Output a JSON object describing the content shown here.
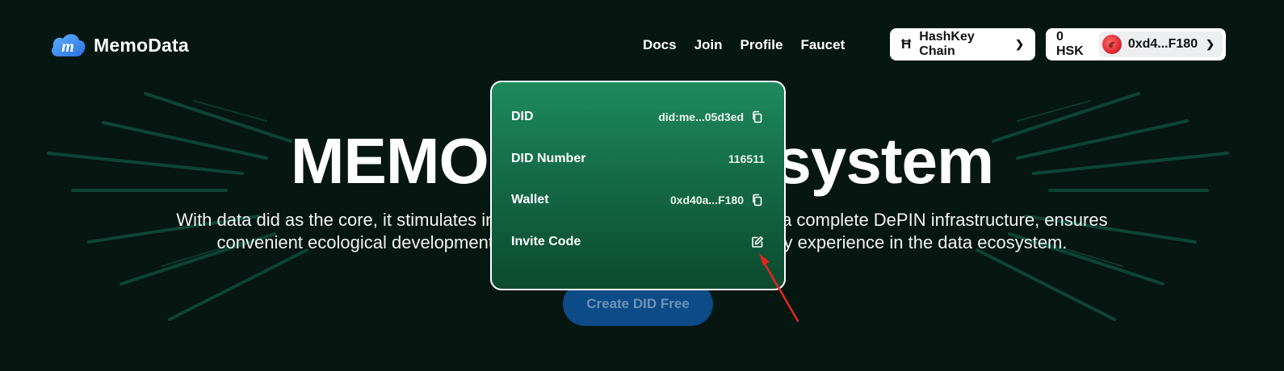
{
  "brand": {
    "name": "MemoData"
  },
  "nav": {
    "items": [
      "Docs",
      "Join",
      "Profile",
      "Faucet"
    ]
  },
  "chain": {
    "label": "HashKey Chain"
  },
  "wallet": {
    "balance": "0 HSK",
    "address": "0xd4...F180"
  },
  "hero": {
    "title": "MEMO Data Ecosystem",
    "description_line1": "With data did as the core, it stimulates innovation of data applications, builds a complete DePIN infrastructure, ensures",
    "description_line2": "convenient ecological development, and helps users obtain a high-quality experience in the data ecosystem.",
    "cta": "Create DID Free"
  },
  "did_panel": {
    "did_label": "DID",
    "did_value": "did:me...05d3ed",
    "did_number_label": "DID Number",
    "did_number_value": "116511",
    "wallet_label": "Wallet",
    "wallet_value": "0xd40a...F180",
    "invite_label": "Invite Code"
  },
  "colors": {
    "background": "#061611",
    "panel_top": "#1f8a5e",
    "panel_bottom": "#0c4a2f",
    "cta": "#0c4b87",
    "annotation_arrow": "#e8251c"
  }
}
